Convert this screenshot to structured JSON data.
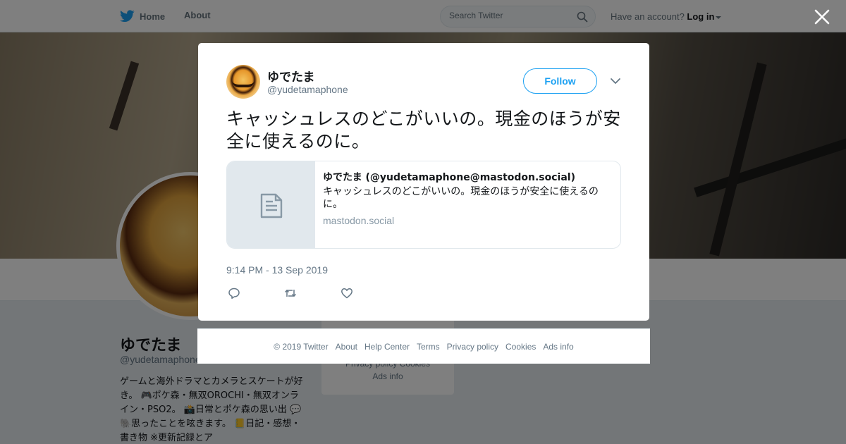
{
  "topbar": {
    "home_label": "Home",
    "about_label": "About",
    "search_placeholder": "Search Twitter",
    "account_text": "Have an account?",
    "login_label": "Log in"
  },
  "profile": {
    "name": "ゆでたま",
    "handle": "@yudetamaphone",
    "bio": "ゲームと海外ドラマとカメラとスケートが好き。 🎮ポケ森・無双OROCHI・無双オンライン・PSO2。 📸日常とポケ森の思い出 💬🐘思ったことを呟きます。 📒日記・感想・書き物 ※更新記録とア"
  },
  "background_footer": {
    "line1": "Privacy policy   Cookies",
    "line2": "Ads info"
  },
  "tweet": {
    "user_name": "ゆでたま",
    "user_handle": "@yudetamaphone",
    "follow_label": "Follow",
    "text": "キャッシュレスのどこがいいの。現金のほうが安全に使えるのに。",
    "card": {
      "title": "ゆでたま (@yudetamaphone@mastodon.social)",
      "description": "キャッシュレスのどこがいいの。現金のほうが安全に使えるのに。",
      "domain": "mastodon.social"
    },
    "timestamp": "9:14 PM - 13 Sep 2019"
  },
  "footer": {
    "copyright": "© 2019 Twitter",
    "links": [
      "About",
      "Help Center",
      "Terms",
      "Privacy policy",
      "Cookies",
      "Ads info"
    ]
  },
  "colors": {
    "twitter_blue": "#1da1f2",
    "text_primary": "#14171a",
    "text_secondary": "#657786"
  },
  "icons": [
    "twitter-bird-icon",
    "search-icon",
    "close-icon",
    "chevron-down-icon",
    "document-icon",
    "reply-icon",
    "retweet-icon",
    "like-icon"
  ]
}
